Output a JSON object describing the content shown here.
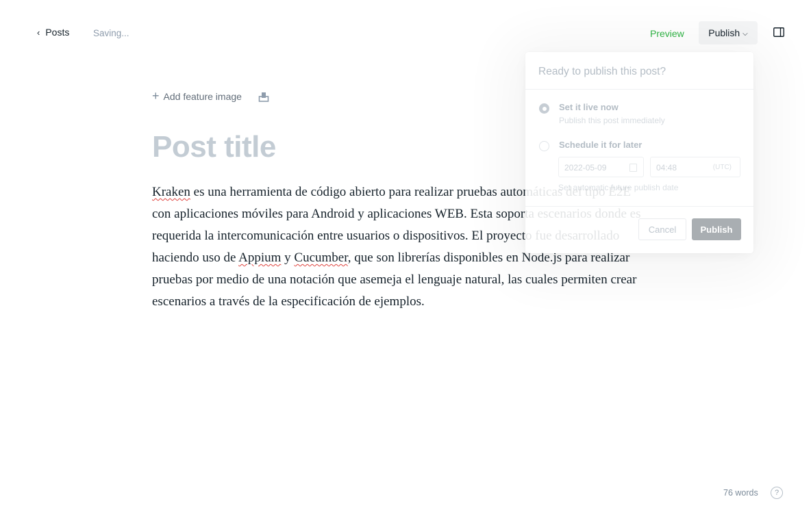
{
  "header": {
    "back_label": "Posts",
    "status": "Saving...",
    "preview_label": "Preview",
    "publish_label": "Publish"
  },
  "editor": {
    "feature_image_label": "Add feature image",
    "title_placeholder": "Post title",
    "body": [
      {
        "text": "Kraken",
        "sq": true
      },
      {
        "text": " es una herramienta de código abierto para realizar pruebas automáticas del tipo E2E con aplicaciones móviles para Android y aplicaciones WEB. Esta soporta escenarios donde es requerida la intercomunicación entre usuarios o dispositivos. El proyecto fue desarrollado haciendo uso de "
      },
      {
        "text": "Appium",
        "sq": true
      },
      {
        "text": " y "
      },
      {
        "text": "Cucumber",
        "sq": true
      },
      {
        "text": ", que son librerías disponibles en Node.js para realizar pruebas por medio de una notación que asemeja el lenguaje natural, las cuales permiten crear escenarios a través de la especificación de ejemplos."
      }
    ]
  },
  "publish_menu": {
    "title": "Ready to publish this post?",
    "options": [
      {
        "title": "Set it live now",
        "desc": "Publish this post immediately",
        "selected": true
      },
      {
        "title": "Schedule it for later",
        "selected": false
      }
    ],
    "date_value": "2022-05-09",
    "time_value": "04:48",
    "timezone": "(UTC)",
    "schedule_hint": "Set automatic future publish date",
    "cancel_label": "Cancel",
    "publish_label": "Publish"
  },
  "footer": {
    "word_count": "76 words",
    "help_glyph": "?"
  },
  "colors": {
    "accent_green": "#2fb344",
    "text": "#15212a",
    "muted": "#7c8b9a",
    "placeholder_title": "#c3ccd4",
    "spellcheck": "#e0443f"
  }
}
